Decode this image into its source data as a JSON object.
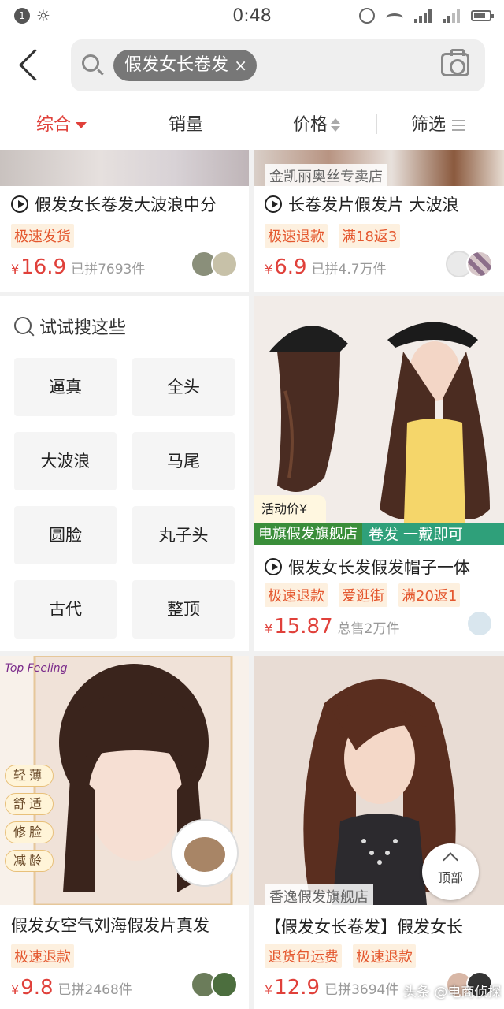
{
  "status_bar": {
    "notification_count": "1",
    "time": "0:48"
  },
  "search": {
    "query_chip": "假发女长卷发",
    "clear_glyph": "×"
  },
  "sort_tabs": [
    {
      "label": "综合",
      "active": true
    },
    {
      "label": "销量"
    },
    {
      "label": "价格"
    },
    {
      "label": "筛选"
    }
  ],
  "products": [
    {
      "title": "假发女长卷发大波浪中分",
      "has_video": true,
      "tags": [
        "极速发货"
      ],
      "price_symbol": "¥",
      "price": "16.9",
      "sold": "已拼7693件"
    },
    {
      "store_badge": "金凯丽奥丝专卖店",
      "title": "长卷发片假发片 大波浪",
      "has_video": true,
      "tags": [
        "极速退款",
        "满18返3"
      ],
      "price_symbol": "¥",
      "price": "6.9",
      "sold": "已拼4.7万件"
    },
    {
      "promo_text": "活动价¥",
      "brand_left": "电旗假发旗舰店",
      "brand_right": "卷发 一戴即可",
      "title": "假发女长发假发帽子一体",
      "has_video": true,
      "tags": [
        "极速退款",
        "爱逛街",
        "满20返1"
      ],
      "price_symbol": "¥",
      "price": "15.87",
      "sold": "总售2万件"
    },
    {
      "logo_text": "Top Feeling",
      "side_tags": [
        "轻薄",
        "舒适",
        "修脸",
        "减龄"
      ],
      "title": "假发女空气刘海假发片真发",
      "tags": [
        "极速退款"
      ],
      "price_symbol": "¥",
      "price": "9.8",
      "sold": "已拼2468件"
    },
    {
      "store_badge": "香逸假发旗舰店",
      "title": "【假发女长卷发】假发女长",
      "tags": [
        "退货包运费",
        "极速退款"
      ],
      "price_symbol": "¥",
      "price": "12.9",
      "sold": "已拼3694件"
    }
  ],
  "suggestions": {
    "title": "试试搜这些",
    "items": [
      "逼真",
      "全头",
      "大波浪",
      "马尾",
      "圆脸",
      "丸子头",
      "古代",
      "整顶"
    ]
  },
  "back_to_top": "顶部",
  "watermark": "头条 @电商侦探",
  "colors": {
    "accent": "#e0403a",
    "tag_bg": "#fdf0df",
    "tag_text": "#e4572e"
  }
}
